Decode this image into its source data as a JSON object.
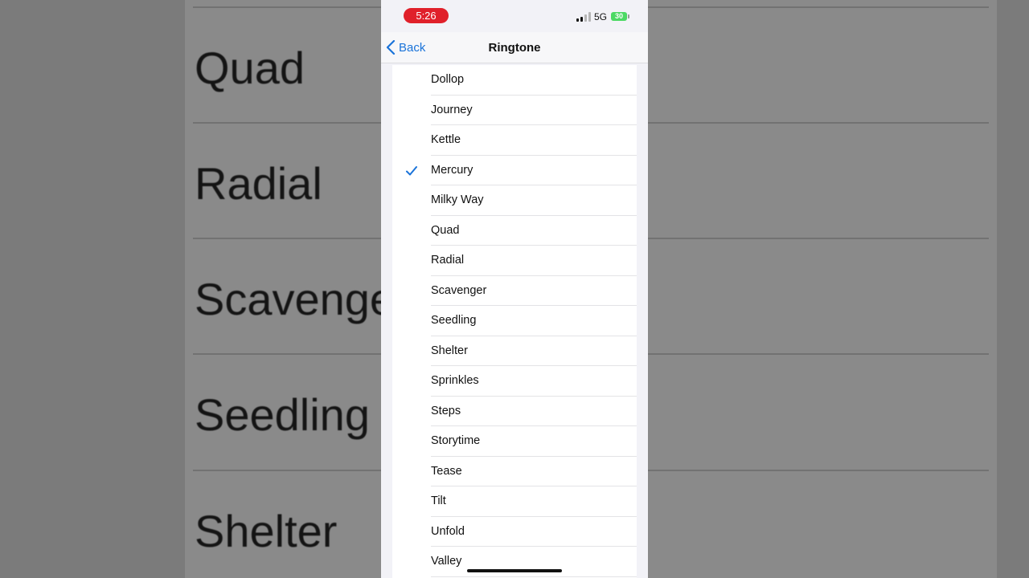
{
  "background": {
    "rows": [
      "Quad",
      "Radial",
      "Scavenge",
      "Seedling",
      "Shelter"
    ]
  },
  "status_bar": {
    "time": "5:26",
    "network": "5G",
    "battery": "30"
  },
  "nav": {
    "back_label": "Back",
    "title": "Ringtone"
  },
  "ringtones": {
    "selected": "Mercury",
    "items": [
      "Dollop",
      "Journey",
      "Kettle",
      "Mercury",
      "Milky Way",
      "Quad",
      "Radial",
      "Scavenger",
      "Seedling",
      "Shelter",
      "Sprinkles",
      "Steps",
      "Storytime",
      "Tease",
      "Tilt",
      "Unfold",
      "Valley"
    ]
  },
  "colors": {
    "accent": "#1a73d9",
    "time_pill": "#e0202a",
    "battery": "#4cd964"
  },
  "icons": {
    "back": "chevron-left-icon",
    "selected": "checkmark-icon"
  }
}
